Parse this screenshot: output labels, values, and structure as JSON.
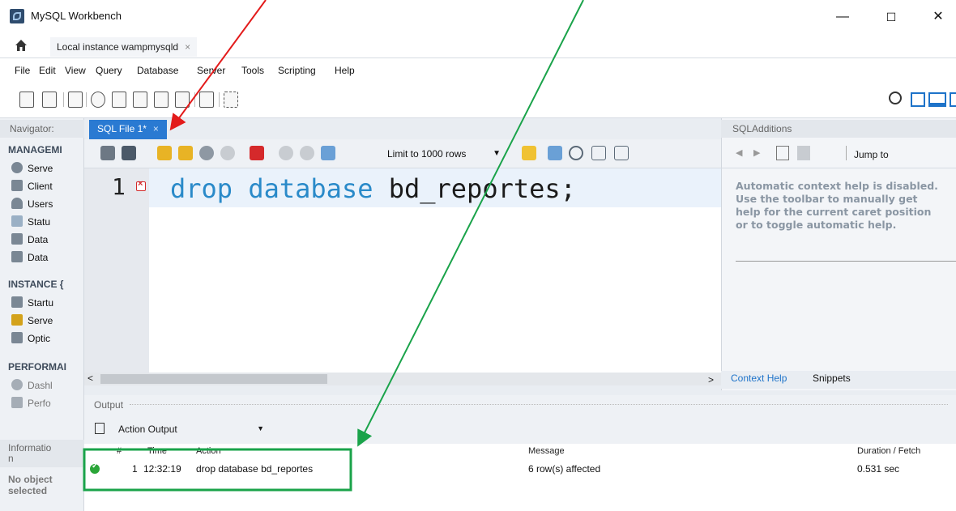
{
  "window": {
    "title": "MySQL Workbench",
    "minimize": "—",
    "maximize": "☐",
    "close": "✕"
  },
  "doc_tab": {
    "label": "Local instance wampmysqld",
    "close": "×"
  },
  "menu": [
    "File",
    "Edit",
    "View",
    "Query",
    "Database",
    "Server",
    "Tools",
    "Scripting",
    "Help"
  ],
  "navigator": {
    "header": "Navigator:",
    "management": {
      "title": "MANAGEMI",
      "items": [
        "Serve",
        "Client",
        "Users",
        "Statu",
        "Data",
        "Data"
      ]
    },
    "instance": {
      "title": "INSTANCE {",
      "items": [
        "Startu",
        "Serve",
        "Optic"
      ]
    },
    "performance": {
      "title": "PERFORMAI",
      "items": [
        "Dashl",
        "Perfo"
      ]
    },
    "info_header": "Informatio\nn",
    "no_object": "No object selected"
  },
  "editor": {
    "tab_label": "SQL File 1*",
    "tab_close": "×",
    "limit_select": "Limit to 1000 rows",
    "line_number": "1",
    "code_keyword": "drop database",
    "code_identifier": "bd_reportes;"
  },
  "sql_additions": {
    "header": "SQLAdditions",
    "jump_to": "Jump to",
    "help_lines": [
      "Automatic context help is disabled.",
      "Use the toolbar to manually get",
      "help for the current caret position",
      "or to toggle automatic help."
    ],
    "tabs": [
      "Context Help",
      "Snippets"
    ]
  },
  "output": {
    "header": "Output",
    "select": "Action Output",
    "columns": [
      "#",
      "Time",
      "Action",
      "Message",
      "Duration / Fetch"
    ],
    "rows": [
      {
        "num": "1",
        "time": "12:32:19",
        "action": "drop database bd_reportes",
        "message": "6 row(s) affected",
        "duration": "0.531 sec"
      }
    ]
  },
  "colors": {
    "accent": "#2a7ad2",
    "annotation_red": "#e31b1b",
    "annotation_green": "#1aa34a"
  }
}
